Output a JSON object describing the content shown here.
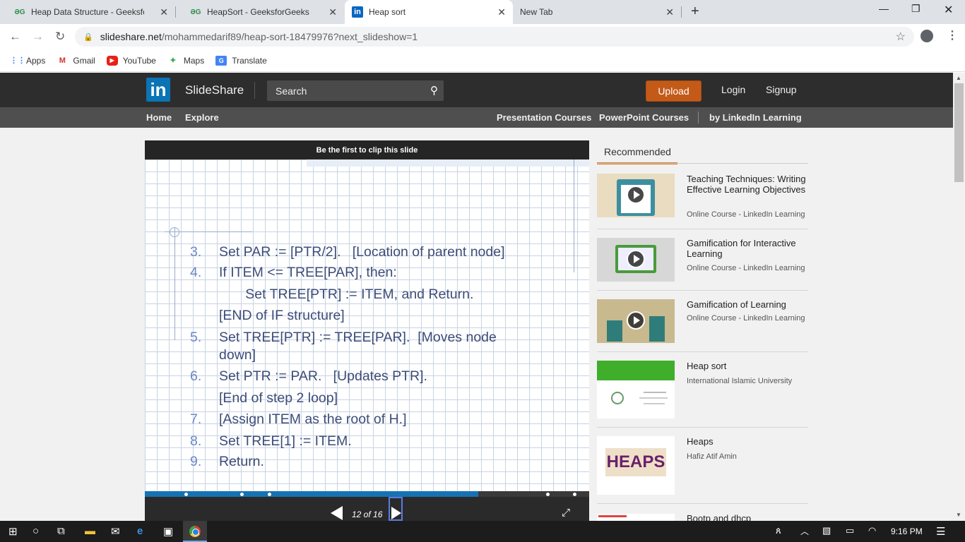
{
  "browser": {
    "tabs": [
      {
        "label": "Heap Data Structure - GeeksforG",
        "favicon": "gfg-icon",
        "active": false
      },
      {
        "label": "HeapSort - GeeksforGeeks",
        "favicon": "gfg-icon",
        "active": false
      },
      {
        "label": "Heap sort",
        "favicon": "linkedin-icon",
        "active": true
      },
      {
        "label": "New Tab",
        "favicon": "",
        "active": false
      }
    ],
    "url_domain": "slideshare.net",
    "url_path": "/mohammedarif89/heap-sort-18479976?next_slideshow=1",
    "bookmarks": [
      {
        "label": "Apps",
        "icon": "apps-grid-icon"
      },
      {
        "label": "Gmail",
        "icon": "gmail-icon"
      },
      {
        "label": "YouTube",
        "icon": "youtube-icon"
      },
      {
        "label": "Maps",
        "icon": "maps-icon"
      },
      {
        "label": "Translate",
        "icon": "translate-icon"
      }
    ]
  },
  "header": {
    "logo_text": "in",
    "brand": "SlideShare",
    "search_placeholder": "Search",
    "upload_label": "Upload",
    "login_label": "Login",
    "signup_label": "Signup"
  },
  "subnav": {
    "home": "Home",
    "explore": "Explore",
    "presentation_courses": "Presentation Courses",
    "powerpoint_courses": "PowerPoint Courses",
    "linkedin_learning": "by LinkedIn Learning"
  },
  "slide": {
    "clip_banner": "Be the first to clip this slide",
    "lines": [
      {
        "num": "3.",
        "text": "Set PAR := [PTR/2].   [Location of parent node]"
      },
      {
        "num": "4.",
        "text": "If ITEM <= TREE[PAR], then:"
      },
      {
        "num": "",
        "text": "   Set TREE[PTR] := ITEM, and Return."
      },
      {
        "num": "",
        "text": "[END of IF structure]"
      },
      {
        "num": "5.",
        "text": "Set TREE[PTR] := TREE[PAR].  [Moves node"
      },
      {
        "num": "",
        "text": "down]"
      },
      {
        "num": "6.",
        "text": "Set PTR := PAR.   [Updates PTR]."
      },
      {
        "num": "",
        "text": "[End of step 2 loop]"
      },
      {
        "num": "7.",
        "text": "[Assign ITEM as the root of H.]"
      },
      {
        "num": "8.",
        "text": "Set TREE[1] := ITEM."
      },
      {
        "num": "9.",
        "text": "Return."
      }
    ],
    "page_indicator": "12 of 16",
    "current_page": 12,
    "total_pages": 16,
    "progress_fraction": 0.75
  },
  "recommended": {
    "tab_label": "Recommended",
    "items": [
      {
        "title": "Teaching Techniques: Writing Effective Learning Objectives",
        "subtitle": "Online Course - LinkedIn Learning",
        "video": true
      },
      {
        "title": "Gamification for Interactive Learning",
        "subtitle": "Online Course - LinkedIn Learning",
        "video": true
      },
      {
        "title": "Gamification of Learning",
        "subtitle": "Online Course - LinkedIn Learning",
        "video": true
      },
      {
        "title": "Heap sort",
        "subtitle": "International Islamic University",
        "video": false
      },
      {
        "title": "Heaps",
        "subtitle": "Hafiz Atif Amin",
        "video": false,
        "thumb_text": "HEAPS"
      },
      {
        "title": "Bootp and dhcp",
        "subtitle": "",
        "video": false
      }
    ]
  },
  "taskbar": {
    "time": "9:16 PM"
  },
  "colors": {
    "header_bg": "#2d2d2d",
    "subnav_bg": "#4f4f4f",
    "upload_orange": "#c35a18",
    "linkedin_blue": "#0a74b5",
    "progress_blue": "#1672b3",
    "recommended_underline": "#d47a2c"
  }
}
